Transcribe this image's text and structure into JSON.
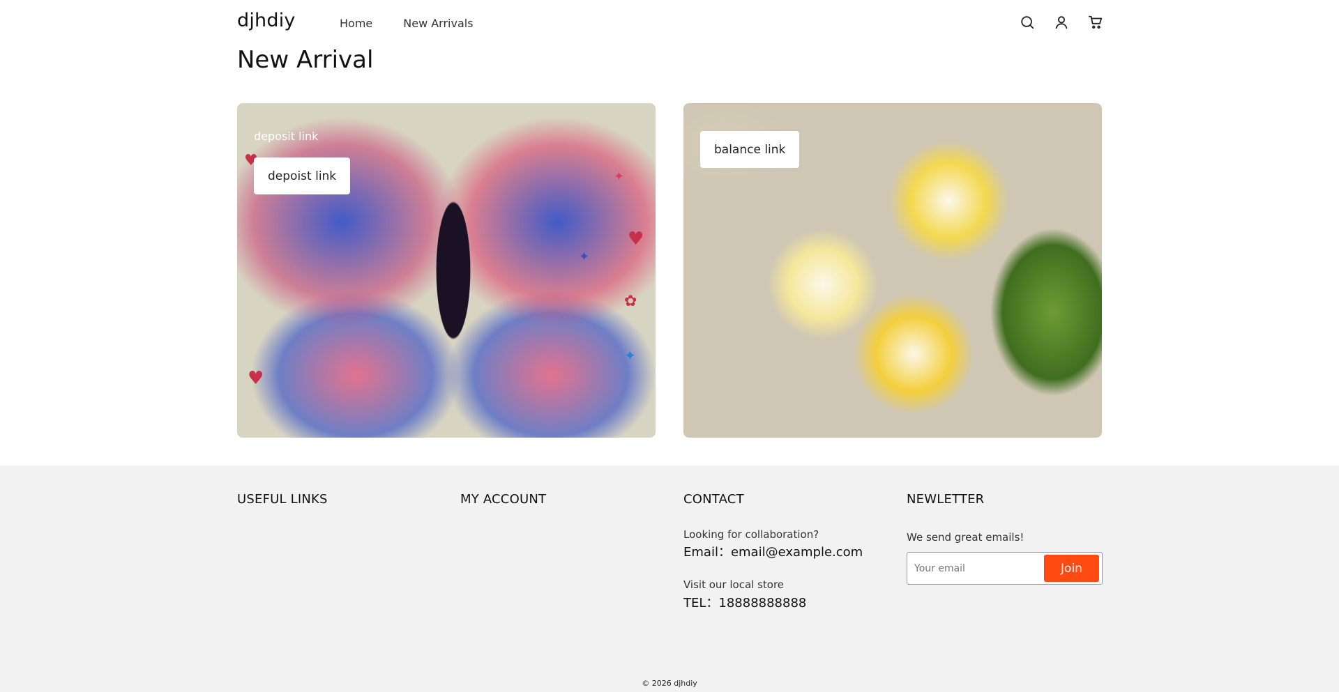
{
  "header": {
    "logo": "djhdiy",
    "nav": [
      "Home",
      "New Arrivals"
    ],
    "icons": [
      "search-icon",
      "account-icon",
      "cart-icon"
    ]
  },
  "main": {
    "title": "New Arrival",
    "cards": [
      {
        "overlay_text": "deposit link",
        "button_label": "depoist link",
        "image": "butterfly"
      },
      {
        "overlay_text": "",
        "button_label": "balance link",
        "image": "plumeria-flowers"
      }
    ]
  },
  "footer": {
    "columns": {
      "useful_links": "USEFUL LINKS",
      "my_account": "MY ACCOUNT",
      "contact": "CONTACT",
      "newsletter": "NEWLETTER"
    },
    "contact": {
      "collab_label": "Looking for collaboration?",
      "email": "Email：email@example.com",
      "store_label": "Visit our local store",
      "tel": "TEL：18888888888"
    },
    "newsletter": {
      "text": "We send great emails!",
      "placeholder": "Your email",
      "join_label": "Join"
    },
    "copyright": "© 2026 djhdiy"
  },
  "colors": {
    "accent": "#ff4a12",
    "footer_bg": "#f2f2f2"
  }
}
